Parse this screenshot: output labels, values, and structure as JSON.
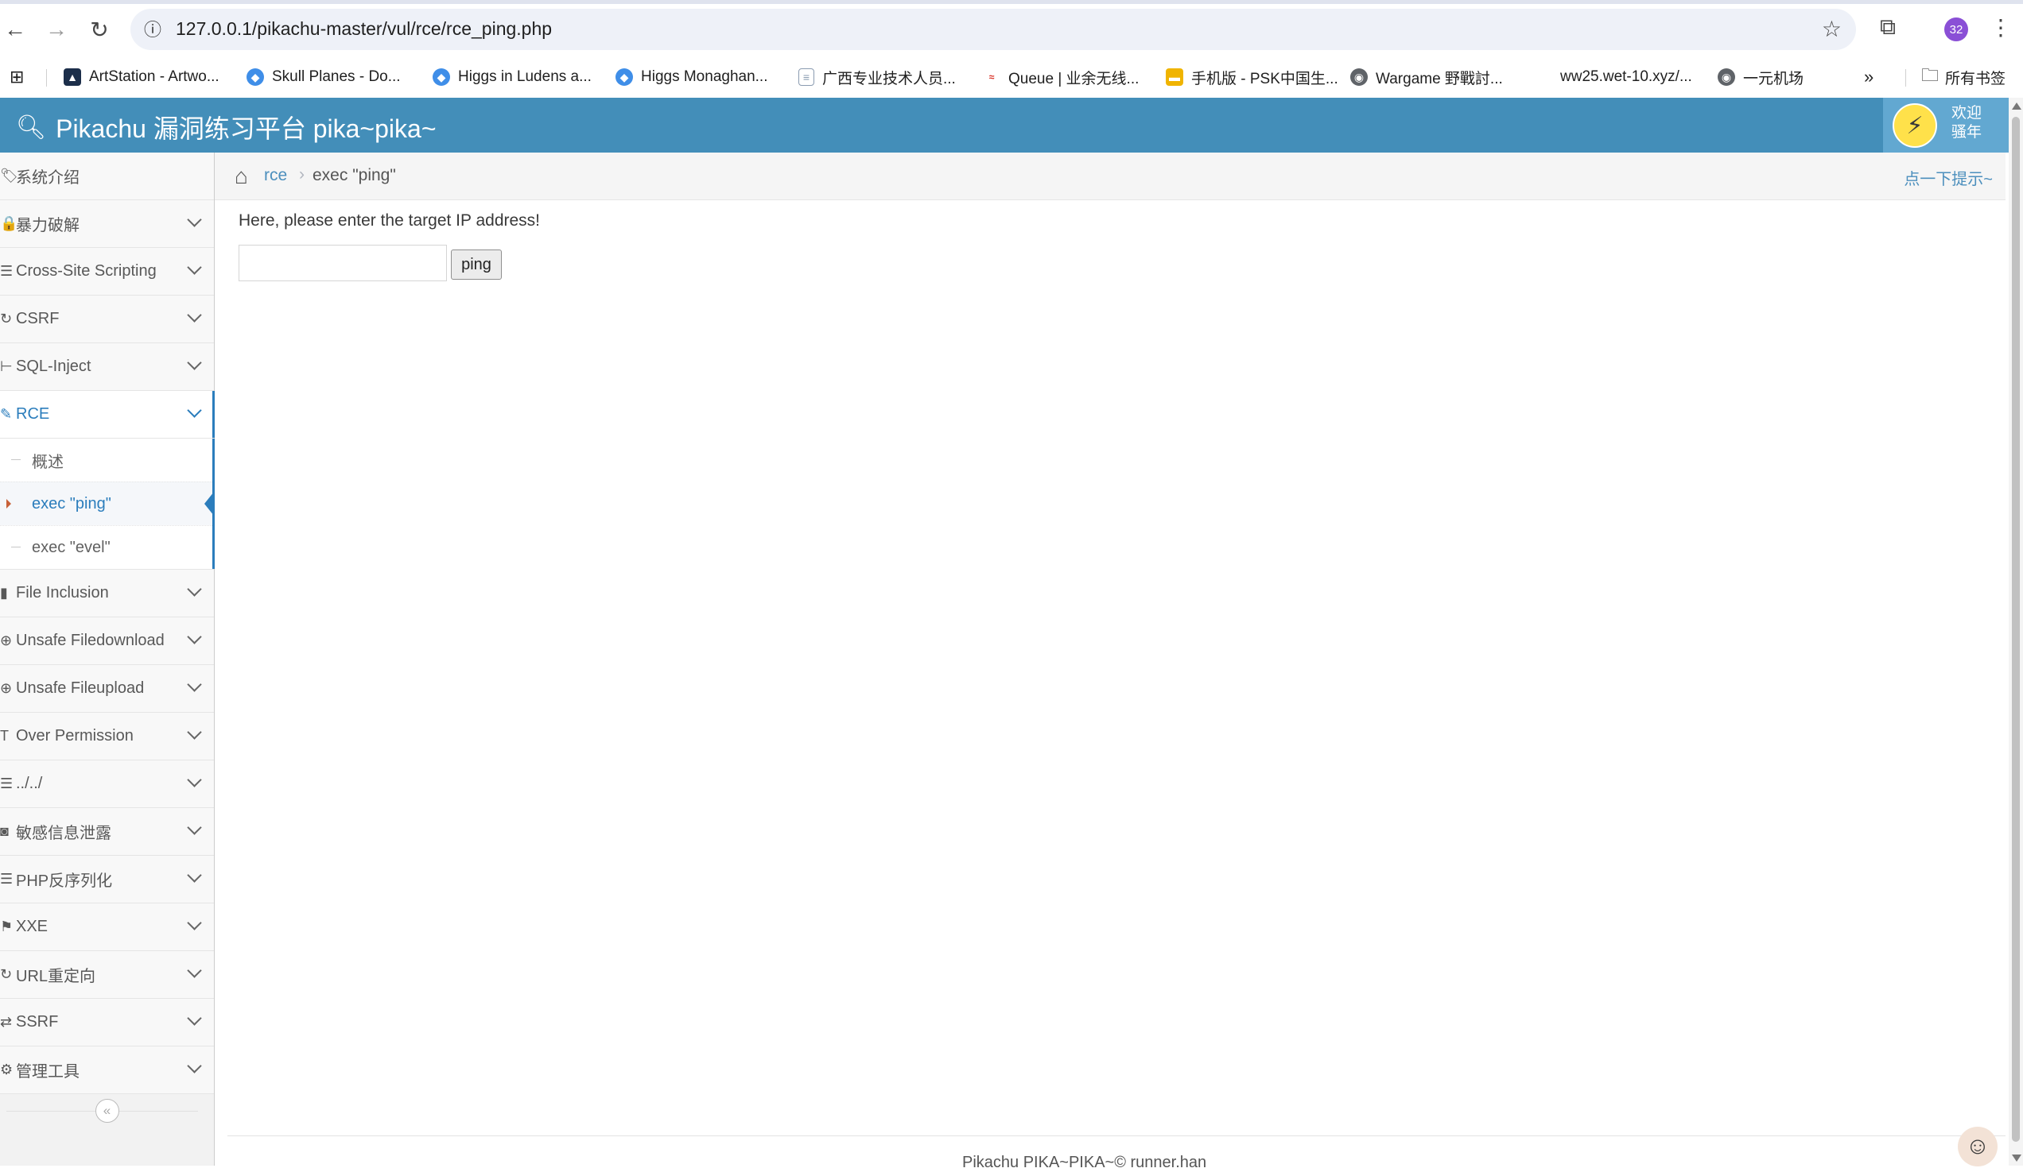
{
  "browser": {
    "url": "127.0.0.1/pikachu-master/vul/rce/rce_ping.php",
    "profile_badge": "32",
    "bookmarks": [
      {
        "label": "ArtStation - Artwo...",
        "icon": "artstation-icon",
        "color": "#13aff0"
      },
      {
        "label": "Skull Planes - Do...",
        "icon": "skull-planes-icon",
        "color": "#3f8ee8"
      },
      {
        "label": "Higgs in Ludens a...",
        "icon": "higgs-icon",
        "color": "#3f8ee8"
      },
      {
        "label": "Higgs Monaghan...",
        "icon": "higgs-icon",
        "color": "#3f8ee8"
      },
      {
        "label": "广西专业技术人员...",
        "icon": "doc-icon",
        "color": "#8a9bb0"
      },
      {
        "label": "Queue | 业余无线...",
        "icon": "queue-icon",
        "color": "#d93025"
      },
      {
        "label": "手机版 - PSK中国生...",
        "icon": "psk-icon",
        "color": "#f0b400"
      },
      {
        "label": "Wargame 野戰討...",
        "icon": "globe-icon",
        "color": "#5f6368"
      },
      {
        "label": "ww25.wet-10.xyz/...",
        "icon": "",
        "color": "#ffffff"
      },
      {
        "label": "一元机场",
        "icon": "globe-icon",
        "color": "#5f6368"
      }
    ],
    "all_bookmarks": "所有书签"
  },
  "header": {
    "title": "Pikachu 漏洞练习平台 pika~pika~",
    "user_line1": "欢迎",
    "user_line2": "骚年"
  },
  "sidebar": {
    "items": [
      {
        "label": "系统介绍",
        "icon": "tags-icon",
        "glyph": "🏷",
        "has_chevron": false
      },
      {
        "label": "暴力破解",
        "icon": "lock-icon",
        "glyph": "🔒",
        "has_chevron": true
      },
      {
        "label": "Cross-Site Scripting",
        "icon": "list-icon",
        "glyph": "☰",
        "has_chevron": true
      },
      {
        "label": "CSRF",
        "icon": "share-icon",
        "glyph": "↻",
        "has_chevron": true
      },
      {
        "label": "SQL-Inject",
        "icon": "wrench-icon",
        "glyph": "⊢",
        "has_chevron": true
      },
      {
        "label": "RCE",
        "icon": "pencil-icon",
        "glyph": "✎",
        "has_chevron": true,
        "active": true,
        "children": [
          {
            "label": "概述"
          },
          {
            "label": "exec \"ping\"",
            "active": true
          },
          {
            "label": "exec \"evel\""
          }
        ]
      },
      {
        "label": "File Inclusion",
        "icon": "file-icon",
        "glyph": "▮",
        "has_chevron": true
      },
      {
        "label": "Unsafe Filedownload",
        "icon": "download-icon",
        "glyph": "⊕",
        "has_chevron": true
      },
      {
        "label": "Unsafe Fileupload",
        "icon": "upload-icon",
        "glyph": "⊕",
        "has_chevron": true
      },
      {
        "label": "Over Permission",
        "icon": "text-icon",
        "glyph": "T",
        "has_chevron": true
      },
      {
        "label": "../../",
        "icon": "align-icon",
        "glyph": "☰",
        "has_chevron": true
      },
      {
        "label": "敏感信息泄露",
        "icon": "camera-icon",
        "glyph": "◙",
        "has_chevron": true
      },
      {
        "label": "PHP反序列化",
        "icon": "align-icon",
        "glyph": "☰",
        "has_chevron": true
      },
      {
        "label": "XXE",
        "icon": "flag-icon",
        "glyph": "⚑",
        "has_chevron": true
      },
      {
        "label": "URL重定向",
        "icon": "refresh-icon",
        "glyph": "↻",
        "has_chevron": true
      },
      {
        "label": "SSRF",
        "icon": "exchange-icon",
        "glyph": "⇄",
        "has_chevron": true
      },
      {
        "label": "管理工具",
        "icon": "gear-icon",
        "glyph": "⚙",
        "has_chevron": true
      }
    ],
    "collapse_glyph": "«"
  },
  "breadcrumb": {
    "home_glyph": "⌂",
    "parent": "rce",
    "separator": "›",
    "current": "exec \"ping\"",
    "hint": "点一下提示~"
  },
  "main": {
    "prompt": "Here, please enter the target IP address!",
    "input_value": "",
    "button": "ping"
  },
  "footer": {
    "text": "Pikachu PIKA~PIKA~© runner.han"
  },
  "colors": {
    "header": "#438eb9",
    "active": "#2b7dbc",
    "link": "#4c8fbd"
  }
}
